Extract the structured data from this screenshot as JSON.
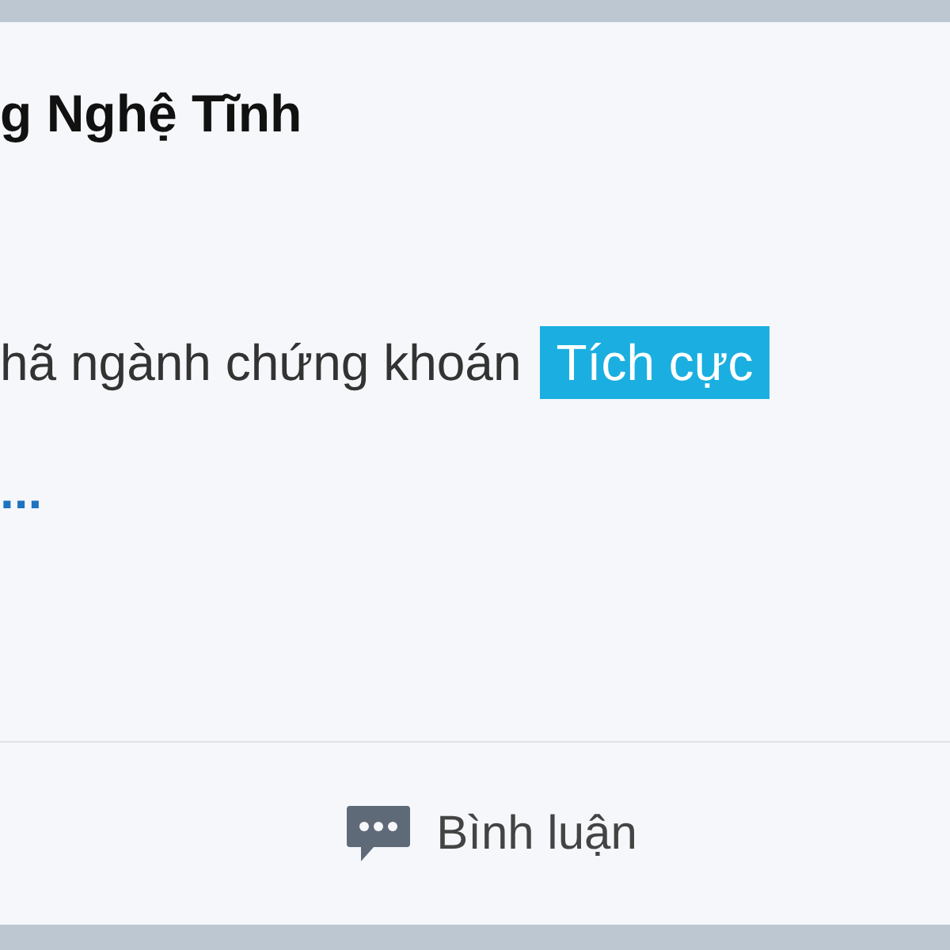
{
  "post": {
    "title": "g Nghệ Tĩnh",
    "body": "hã ngành chứng khoán",
    "tag": "Tích cực",
    "more": "..."
  },
  "actions": [
    {
      "kind": "comment",
      "label": "Bình luận"
    }
  ]
}
